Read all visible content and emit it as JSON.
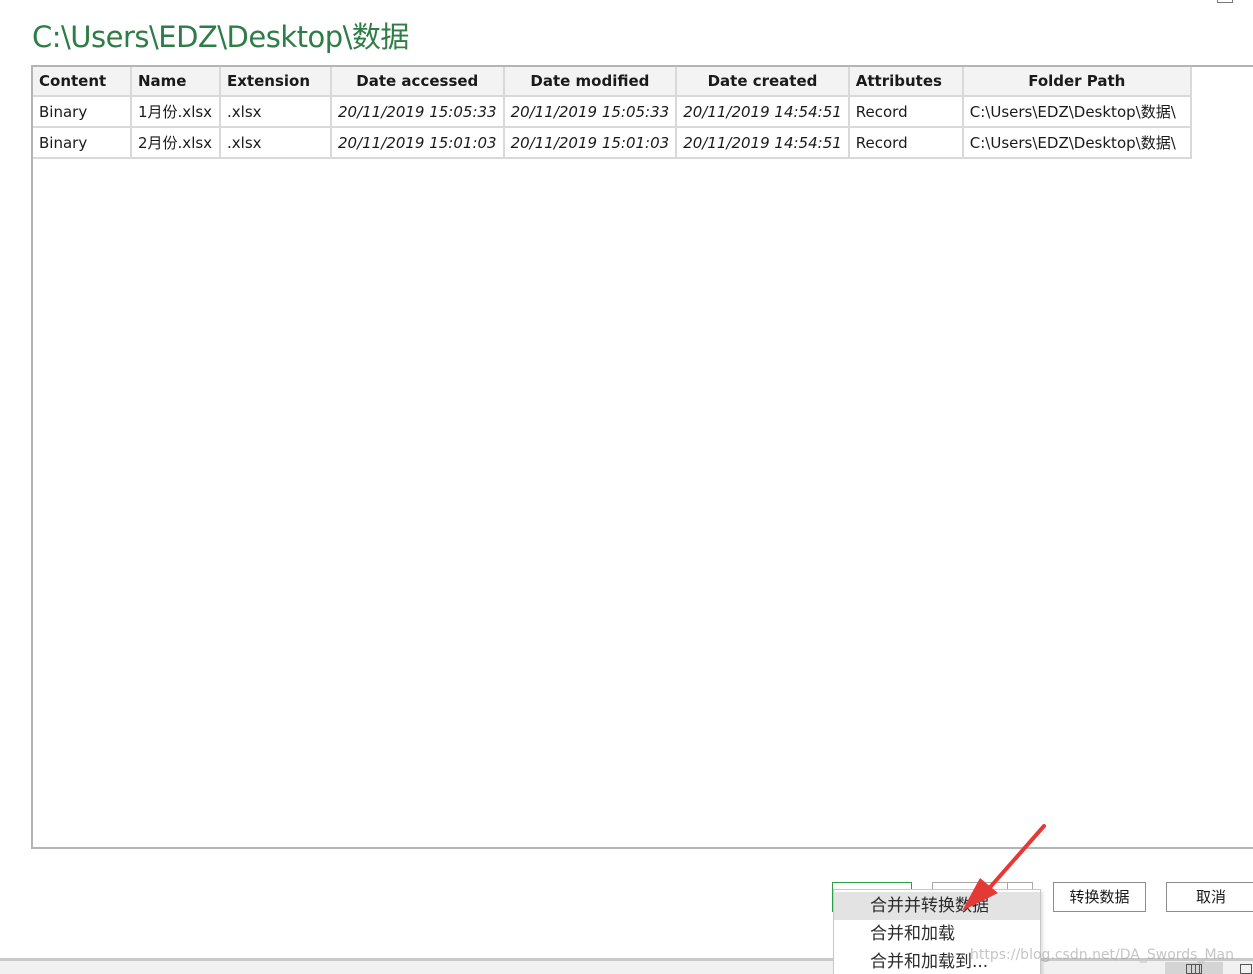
{
  "window": {
    "title": "C:\\Users\\EDZ\\Desktop\\数据"
  },
  "table": {
    "columns": [
      "Content",
      "Name",
      "Extension",
      "Date accessed",
      "Date modified",
      "Date created",
      "Attributes",
      "Folder Path"
    ],
    "rows": [
      [
        "Binary",
        "1月份.xlsx",
        ".xlsx",
        "20/11/2019 15:05:33",
        "20/11/2019 15:05:33",
        "20/11/2019 14:54:51",
        "Record",
        "C:\\Users\\EDZ\\Desktop\\数据\\"
      ],
      [
        "Binary",
        "2月份.xlsx",
        ".xlsx",
        "20/11/2019 15:01:03",
        "20/11/2019 15:01:03",
        "20/11/2019 14:54:51",
        "Record",
        "C:\\Users\\EDZ\\Desktop\\数据\\"
      ]
    ]
  },
  "buttons": {
    "transform": "转换数据",
    "cancel": "取消"
  },
  "dropdown": {
    "items": [
      "合并并转换数据",
      "合并和加载",
      "合并和加载到..."
    ]
  },
  "watermark": "https://blog.csdn.net/DA_Swords_Man",
  "colors": {
    "title": "#2e7d46",
    "annotation_arrow": "#e53935",
    "combine_border": "#2e9e4a"
  },
  "icons": {
    "arrow": "red-annotation-arrow",
    "table_view": "table-view-icon",
    "list_view": "list-view-icon"
  }
}
